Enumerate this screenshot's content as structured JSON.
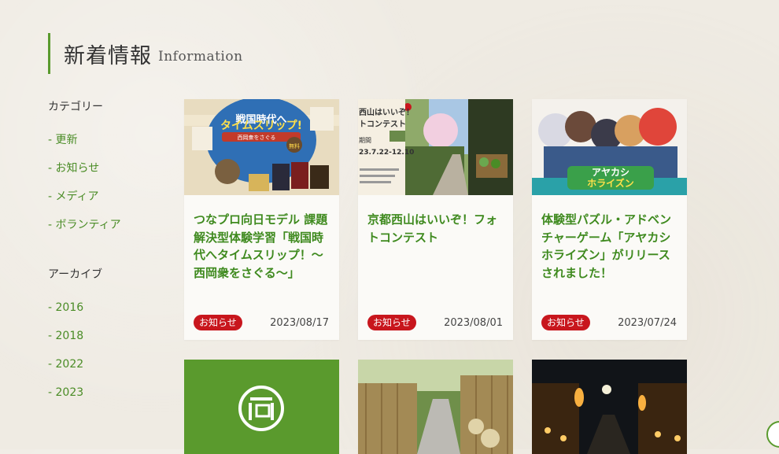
{
  "heading": {
    "title_jp": "新着情報",
    "title_en": "Information"
  },
  "sidebar": {
    "category_title": "カテゴリー",
    "categories": [
      "- 更新",
      "- お知らせ",
      "- メディア",
      "- ボランティア"
    ],
    "archive_title": "アーカイブ",
    "archives": [
      "- 2016",
      "- 2018",
      "- 2022",
      "- 2023"
    ]
  },
  "posts": [
    {
      "title": "つなプロ向日モデル 課題解決型体験学習「戦国時代へタイムスリップ！～西岡衆をさぐる～」",
      "category": "お知らせ",
      "date": "2023/08/17",
      "thumb_text": [
        "戦国時代へ",
        "タイムスリップ!",
        "西岡衆をさぐる",
        "無料"
      ]
    },
    {
      "title": "京都西山はいいぞ！フォトコンテスト",
      "category": "お知らせ",
      "date": "2023/08/01",
      "thumb_text": [
        "西山はいいぞ！",
        "トコンテスト",
        "期間",
        "23.7.22-12.10"
      ]
    },
    {
      "title": "体験型パズル・アドベンチャーゲーム「アヤカシホライズン」がリリースされました！",
      "category": "お知らせ",
      "date": "2023/07/24",
      "thumb_text": [
        "アヤカシ",
        "ホライズン"
      ]
    }
  ],
  "colors": {
    "accent_green": "#5a9a2d",
    "title_green": "#3f8a1f",
    "badge_red": "#c8161d",
    "background": "#efebe3"
  }
}
